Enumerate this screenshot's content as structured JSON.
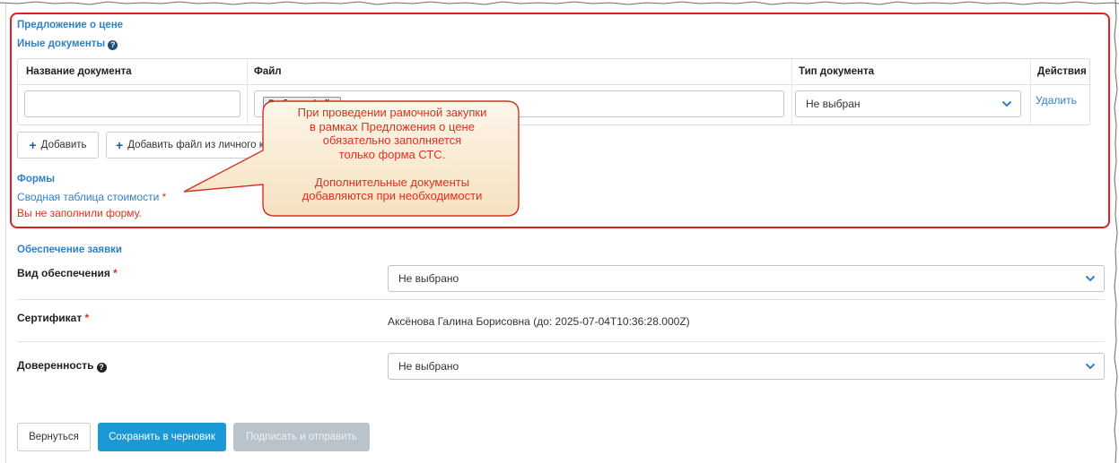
{
  "price_offer": {
    "section_title": "Предложение о цене",
    "other_docs_title": "Иные документы",
    "columns": [
      "Название документа",
      "Файл",
      "Тип документа",
      "Действия"
    ],
    "row": {
      "name_value": "",
      "file_button": "Выбрать файл",
      "doc_type": "Не выбран",
      "delete_link": "Удалить"
    },
    "add_button": "Добавить",
    "add_from_account_button": "Добавить файл из личного кабинета",
    "forms_title": "Формы",
    "summary_table_link": "Сводная таблица стоимости",
    "required_mark": "*",
    "form_error": "Вы не заполнили форму."
  },
  "callout": {
    "lines": [
      "При проведении рамочной закупки",
      "в рамках Предложения о цене",
      "обязательно заполняется",
      "только форма СТС.",
      "",
      "Дополнительные документы",
      "добавляются при необходимости"
    ]
  },
  "security": {
    "section_title": "Обеспечение заявки",
    "type_label": "Вид обеспечения",
    "type_value": "Не выбрано",
    "certificate_label": "Сертификат",
    "certificate_value": "Аксёнова Галина Борисовна (до: 2025-07-04T10:36:28.000Z)",
    "power_label": "Доверенность",
    "power_value": "Не выбрано",
    "required_mark": "*"
  },
  "actions": {
    "back": "Вернуться",
    "save_draft": "Сохранить в черновик",
    "sign_send": "Подписать и отправить"
  },
  "colors": {
    "accent": "#2f80c7",
    "primary_button": "#1a99d6",
    "error": "#e0301e",
    "highlight_frame": "#e02020",
    "callout_fill": "#fbf1df"
  }
}
